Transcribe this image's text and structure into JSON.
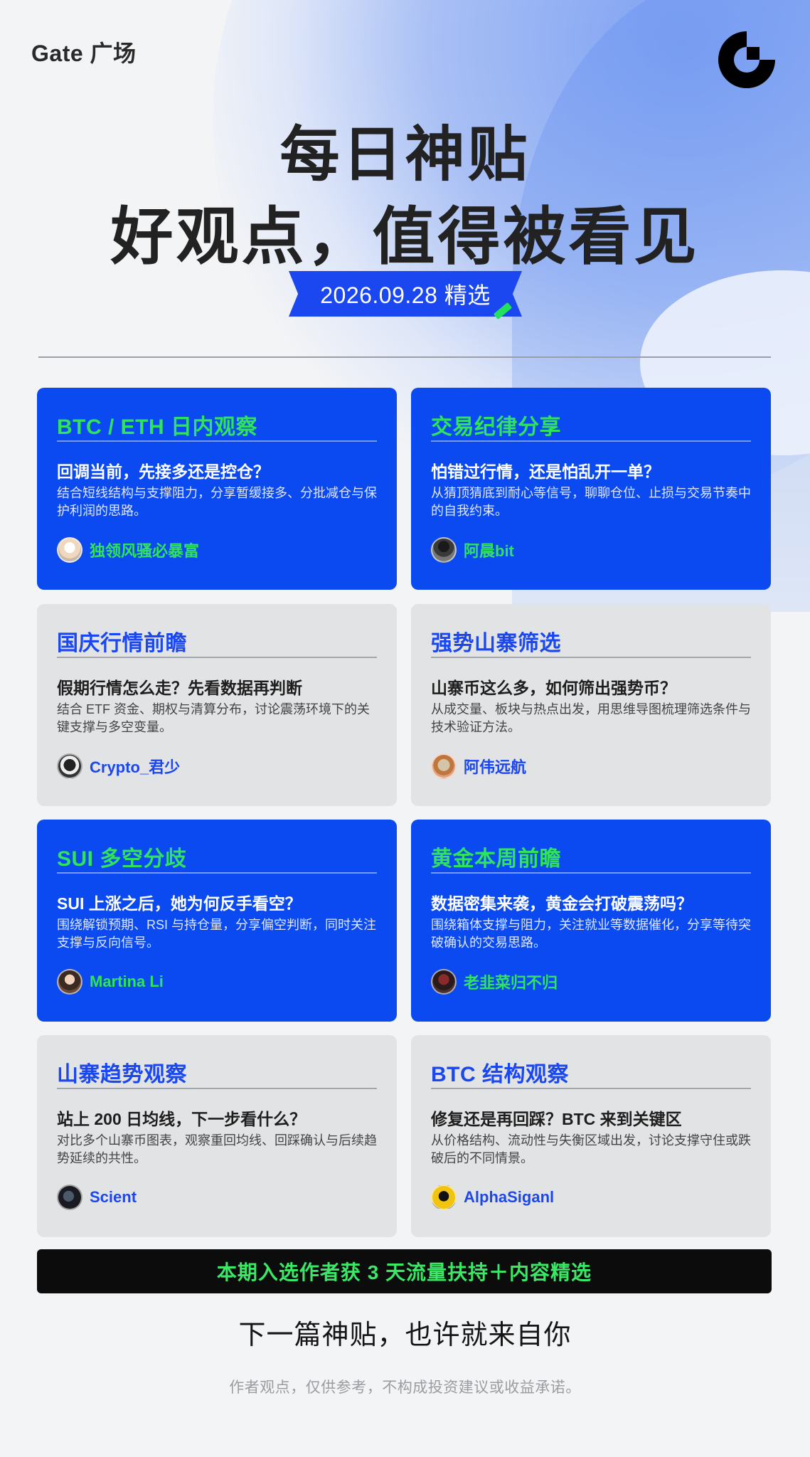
{
  "brand": "Gate 广场",
  "title_line1": "每日神贴",
  "title_line2": "好观点，值得被看见",
  "date_label": "2026.09.28 精选",
  "cards": [
    {
      "header": "BTC / ETH 日内观察",
      "question": "回调当前，先接多还是控仓？",
      "description": "结合短线结构与支撑阻力，分享暂缓接多、分批减仓与保护利润的思路。",
      "author": "独领风骚必暴富",
      "style": "blue"
    },
    {
      "header": "交易纪律分享",
      "question": "怕错过行情，还是怕乱开一单？",
      "description": "从猜顶猜底到耐心等信号，聊聊仓位、止损与交易节奏中的自我约束。",
      "author": "阿晨bit",
      "style": "blue"
    },
    {
      "header": "国庆行情前瞻",
      "question": "假期行情怎么走？先看数据再判断",
      "description": "结合 ETF 资金、期权与清算分布，讨论震荡环境下的关键支撑与多空变量。",
      "author": "Crypto_君少",
      "style": "gray"
    },
    {
      "header": "强势山寨筛选",
      "question": "山寨币这么多，如何筛出强势币？",
      "description": "从成交量、板块与热点出发，用思维导图梳理筛选条件与技术验证方法。",
      "author": "阿伟远航",
      "style": "gray"
    },
    {
      "header": "SUI 多空分歧",
      "question": "SUI 上涨之后，她为何反手看空？",
      "description": "围绕解锁预期、RSI 与持仓量，分享偏空判断，同时关注支撑与反向信号。",
      "author": "Martina Li",
      "style": "blue"
    },
    {
      "header": "黄金本周前瞻",
      "question": "数据密集来袭，黄金会打破震荡吗？",
      "description": "围绕箱体支撑与阻力，关注就业等数据催化，分享等待突破确认的交易思路。",
      "author": "老韭菜归不归",
      "style": "blue"
    },
    {
      "header": "山寨趋势观察",
      "question": "站上 200 日均线，下一步看什么？",
      "description": "对比多个山寨币图表，观察重回均线、回踩确认与后续趋势延续的共性。",
      "author": "Scient",
      "style": "gray"
    },
    {
      "header": "BTC 结构观察",
      "question": "修复还是再回踩？BTC 来到关键区",
      "description": "从价格结构、流动性与失衡区域出发，讨论支撑守住或跌破后的不同情景。",
      "author": "AlphaSiganl",
      "style": "gray"
    }
  ],
  "banner": "本期入选作者获 3 天流量扶持＋内容精选",
  "cta": "下一篇神贴，也许就来自你",
  "disclaimer": "作者观点，仅供参考，不构成投资建议或收益承诺。",
  "colors": {
    "blue": "#0a4af0",
    "green": "#31e25c",
    "gray_card": "#e2e3e5"
  },
  "icons": {
    "logo": "gate-logo-icon",
    "date_mark": "check-mark-icon"
  }
}
